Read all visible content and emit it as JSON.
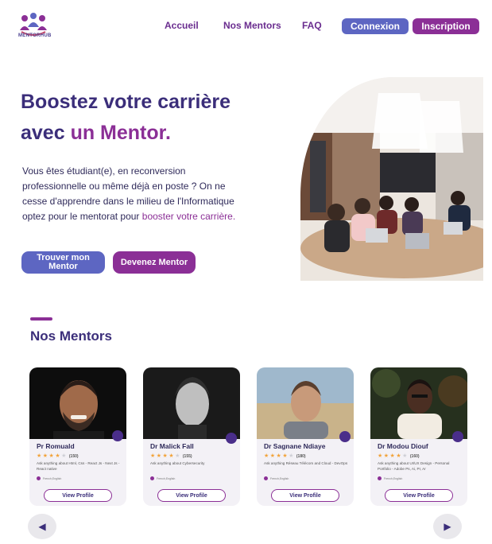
{
  "header": {
    "logo_text": "MENTORHUB",
    "nav": [
      "Accueil",
      "Nos Mentors",
      "FAQ"
    ],
    "login_label": "Connexion",
    "signup_label": "Inscription"
  },
  "hero": {
    "title_line1": "Boostez votre carrière",
    "title_line2_prefix": "avec ",
    "title_line2_accent": "un Mentor.",
    "text_main": "Vous êtes étudiant(e), en reconversion professionnelle ou même déjà en poste ? On ne cesse d'apprendre dans le milieu de l'Informatique optez pour le mentorat pour ",
    "text_accent": "booster votre carrière.",
    "find_mentor_label": "Trouver mon Mentor",
    "become_mentor_label": "Devenez  Mentor"
  },
  "mentors_section": {
    "title": "Nos Mentors",
    "cards": [
      {
        "name": "Pr Romuald",
        "rating": 4,
        "count": "(150)",
        "desc": "Ask anything about Html, Css - React Js - Next Js - React native",
        "lang": "French,English",
        "button": "View Profile"
      },
      {
        "name": "Dr Malick Fall",
        "rating": 4,
        "count": "(155)",
        "desc": "Ask anything about Cybersecurity",
        "lang": "French,English",
        "button": "View Profile"
      },
      {
        "name": "Dr Sagnane Ndiaye",
        "rating": 4,
        "count": "(180)",
        "desc": "Ask anything Réseau Télécom and Cloud - DevOps",
        "lang": "French,English",
        "button": "View Profile"
      },
      {
        "name": "Dr Modou Diouf",
        "rating": 4,
        "count": "(160)",
        "desc": "Ask anything about UI/UX Design - Personal Portfolio - Adobe Ps, Ai, Pr, Ar",
        "lang": "French,English",
        "button": "View Profile"
      }
    ]
  },
  "carousel": {
    "prev_icon": "◀",
    "next_icon": "▶"
  },
  "colors": {
    "primary_blue": "#5d66c2",
    "primary_purple": "#8b2f96",
    "title_navy": "#3b2e7a"
  }
}
